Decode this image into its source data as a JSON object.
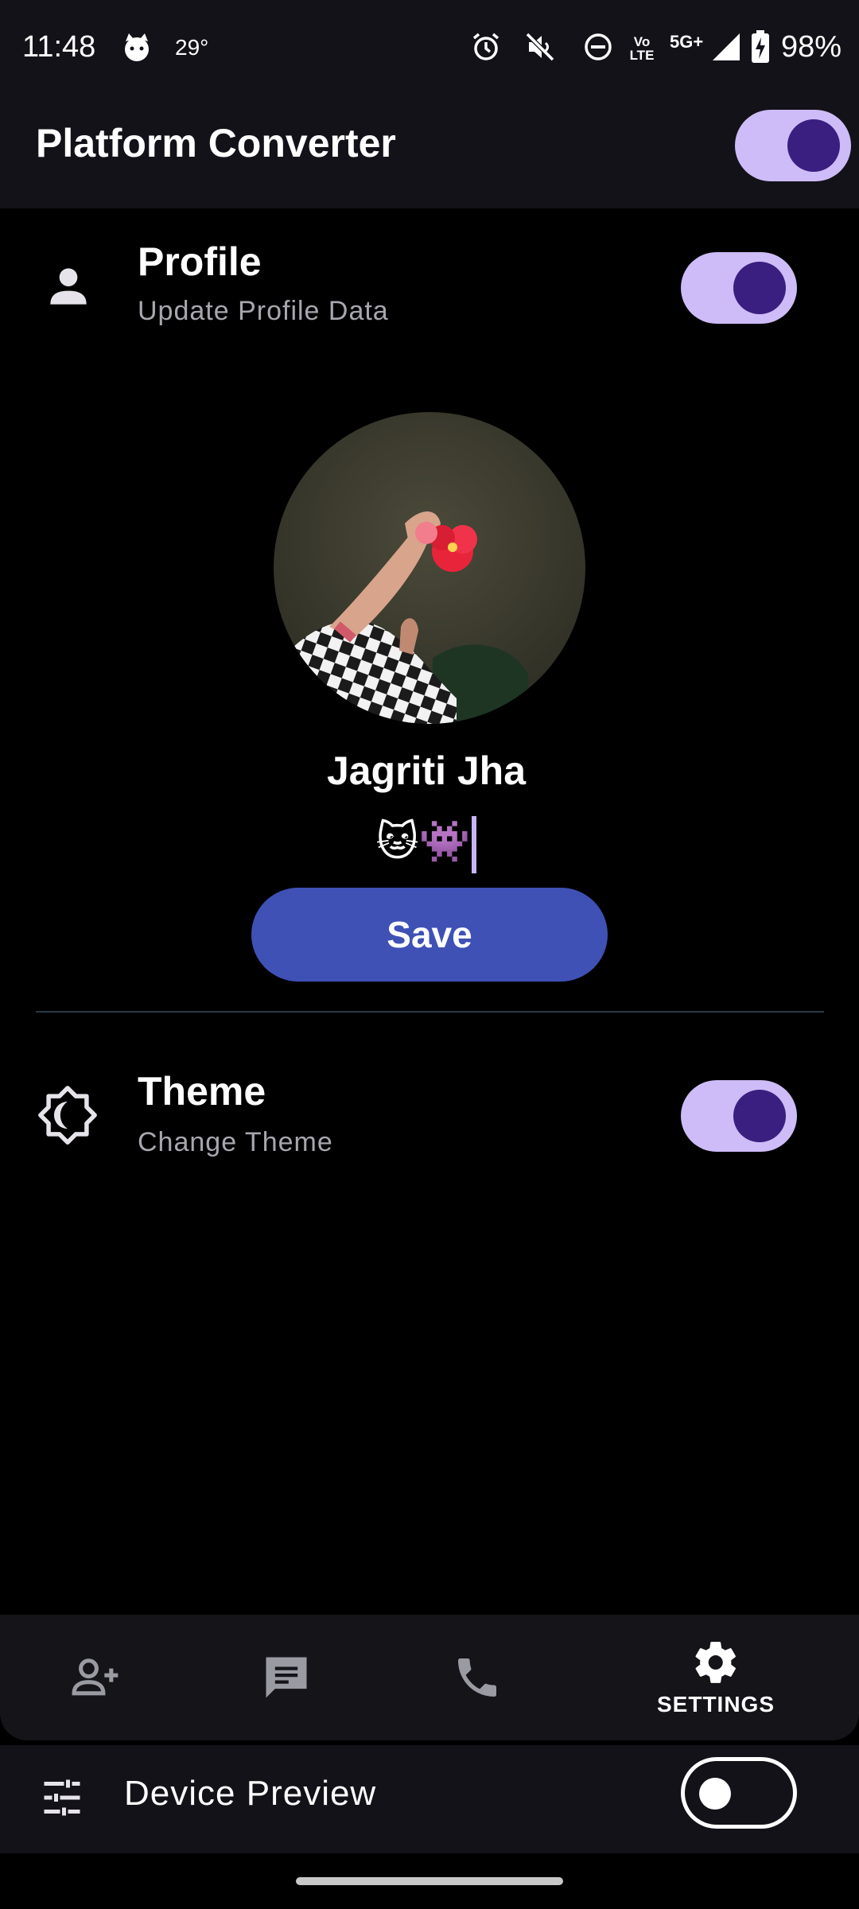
{
  "status_bar": {
    "time": "11:48",
    "temperature": "29°",
    "network": "5G+",
    "volte": "Vo LTE",
    "battery": "98%",
    "icons": [
      "cat-face-icon",
      "alarm-icon",
      "mute-icon",
      "dnd-icon",
      "volte-icon",
      "signal-icon",
      "battery-charging-icon"
    ]
  },
  "app_bar": {
    "title": "Platform Converter",
    "toggle_on": true
  },
  "profile_section": {
    "title": "Profile",
    "subtitle": "Update Profile Data",
    "icon": "person-icon",
    "toggle_on": true,
    "name": "Jagriti Jha",
    "bio": "🐱👾",
    "save_label": "Save"
  },
  "theme_section": {
    "title": "Theme",
    "subtitle": "Change Theme",
    "icon": "brightness-icon",
    "toggle_on": true
  },
  "bottom_nav": {
    "items": [
      {
        "icon": "add-person-icon",
        "label": ""
      },
      {
        "icon": "chat-icon",
        "label": ""
      },
      {
        "icon": "phone-icon",
        "label": ""
      },
      {
        "icon": "settings-gear-icon",
        "label": "SETTINGS"
      }
    ],
    "selected": "SETTINGS"
  },
  "device_preview": {
    "label": "Device Preview",
    "icon": "tune-sliders-icon",
    "toggle_on": false
  },
  "colors": {
    "accent_switch_track": "#cdbcf7",
    "accent_switch_knob": "#3a1f80",
    "save_button": "#3f51b5",
    "surface": "#131219",
    "background": "#000000"
  }
}
